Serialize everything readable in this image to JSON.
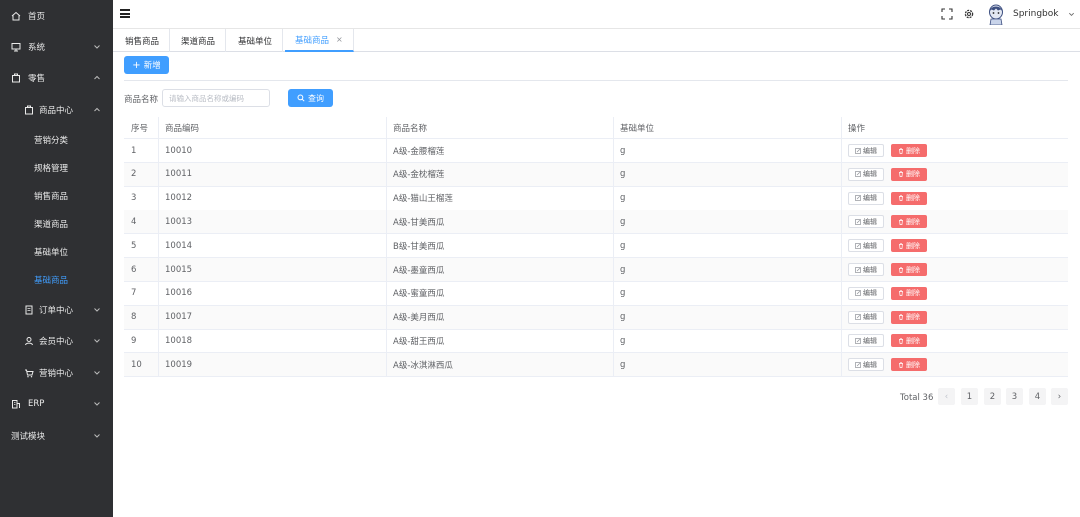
{
  "sidebar": {
    "items": [
      {
        "label": "首页",
        "icon": "home-icon"
      },
      {
        "label": "系统",
        "icon": "monitor-icon"
      },
      {
        "label": "零售",
        "icon": "shop-icon"
      },
      {
        "label": "商品中心",
        "icon": "shop-icon"
      },
      {
        "label": "营销分类"
      },
      {
        "label": "规格管理"
      },
      {
        "label": "销售商品"
      },
      {
        "label": "渠道商品"
      },
      {
        "label": "基础单位"
      },
      {
        "label": "基础商品"
      },
      {
        "label": "订单中心",
        "icon": "document-icon"
      },
      {
        "label": "会员中心",
        "icon": "user-icon"
      },
      {
        "label": "营销中心",
        "icon": "cart-icon"
      },
      {
        "label": "ERP",
        "icon": "building-icon"
      },
      {
        "label": "测试模块"
      }
    ]
  },
  "header": {
    "user_name": "Springbok"
  },
  "tabs": [
    {
      "label": "销售商品"
    },
    {
      "label": "渠道商品"
    },
    {
      "label": "基础单位"
    },
    {
      "label": "基础商品",
      "close": "×"
    }
  ],
  "toolbar": {
    "add_label": "新增"
  },
  "search": {
    "label": "商品名称",
    "placeholder": "请输入商品名称或编码",
    "query_label": "查询"
  },
  "table": {
    "columns": [
      "序号",
      "商品编码",
      "商品名称",
      "基础单位",
      "操作"
    ],
    "edit_label": "编辑",
    "delete_label": "删除",
    "rows": [
      {
        "index": "1",
        "code": "10010",
        "name": "A级-金腰榴莲",
        "unit": "g"
      },
      {
        "index": "2",
        "code": "10011",
        "name": "A级-金枕榴莲",
        "unit": "g"
      },
      {
        "index": "3",
        "code": "10012",
        "name": "A级-猫山王榴莲",
        "unit": "g"
      },
      {
        "index": "4",
        "code": "10013",
        "name": "A级-甘美西瓜",
        "unit": "g"
      },
      {
        "index": "5",
        "code": "10014",
        "name": "B级-甘美西瓜",
        "unit": "g"
      },
      {
        "index": "6",
        "code": "10015",
        "name": "A级-墨童西瓜",
        "unit": "g"
      },
      {
        "index": "7",
        "code": "10016",
        "name": "A级-蜜童西瓜",
        "unit": "g"
      },
      {
        "index": "8",
        "code": "10017",
        "name": "A级-美月西瓜",
        "unit": "g"
      },
      {
        "index": "9",
        "code": "10018",
        "name": "A级-甜王西瓜",
        "unit": "g"
      },
      {
        "index": "10",
        "code": "10019",
        "name": "A级-冰淇淋西瓜",
        "unit": "g"
      }
    ]
  },
  "pagination": {
    "total": "Total 36",
    "pages": [
      "1",
      "2",
      "3",
      "4"
    ],
    "prev": "‹",
    "next": "›"
  },
  "colors": {
    "primary": "#409eff",
    "danger": "#f56c6c",
    "sidebar_bg": "#2f3033"
  }
}
